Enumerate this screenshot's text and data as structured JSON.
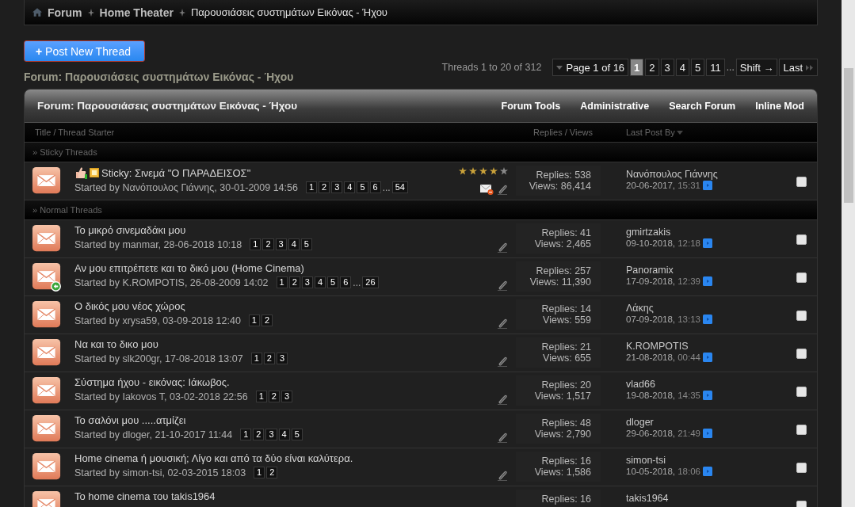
{
  "breadcrumb": {
    "items": [
      "Forum",
      "Home Theater"
    ],
    "current": "Παρουσιάσεις συστημάτων Εικόνας - Ήχου"
  },
  "post_button": {
    "icon": "+",
    "label": "Post New Thread"
  },
  "forum_heading": "Forum: Παρουσιάσεις συστημάτων Εικόνας - Ήχου",
  "pagination": {
    "summary": "Threads 1 to 20 of 312",
    "page_label": "Page 1 of 16",
    "pages": [
      {
        "label": "1",
        "selected": true
      },
      {
        "label": "2",
        "selected": false
      },
      {
        "label": "3",
        "selected": false
      },
      {
        "label": "4",
        "selected": false
      },
      {
        "label": "5",
        "selected": false
      },
      {
        "label": "11",
        "selected": false
      }
    ],
    "gap": "...",
    "next": "Shift →",
    "last": "Last"
  },
  "table": {
    "title": "Forum: Παρουσιάσεις συστημάτων Εικόνας - Ήχου",
    "tools": [
      "Forum Tools",
      "Administrative",
      "Search Forum",
      "Inline Mod"
    ],
    "columns": [
      "Title / Thread Starter",
      "Replies / Views",
      "Last Post By"
    ],
    "sections": [
      {
        "label": "» Sticky Threads",
        "threads": [
          {
            "kind": "sticky",
            "title": "Sticky: Σινεμά \"Ο ΠΑΡΑΔΕΙΣΟΣ\"",
            "starter": "Started by Νανόπουλος Γιάννης, 30-01-2009 14:56",
            "pages": [
              "1",
              "2",
              "3",
              "4",
              "5",
              "6"
            ],
            "gap": "...",
            "last_page": "54",
            "stars": 4,
            "moved": false,
            "replies": "Replies: 538",
            "views": "Views: 86,414",
            "last_poster": "Νανόπουλος Γιάννης",
            "last_date": "20-06-2017,",
            "last_time": "15:31",
            "checked": false
          }
        ]
      },
      {
        "label": "» Normal Threads",
        "threads": [
          {
            "kind": "normal",
            "title": "Το μικρό σινεμαδάκι μου",
            "starter": "Started by manmar, 28-06-2018 10:18",
            "pages": [
              "1",
              "2",
              "3",
              "4",
              "5"
            ],
            "moved": false,
            "replies": "Replies: 41",
            "views": "Views: 2,465",
            "last_poster": "gmirtzakis",
            "last_date": "09-10-2018,",
            "last_time": "12:18",
            "checked": false
          },
          {
            "kind": "normal",
            "title": "Αν μου επιτρέπετε και το δικό μου (Home Cinema)",
            "starter": "Started by K.ROMPOTIS, 26-08-2009 14:02",
            "pages": [
              "1",
              "2",
              "3",
              "4",
              "5",
              "6"
            ],
            "gap": "...",
            "last_page": "26",
            "moved": true,
            "replies": "Replies: 257",
            "views": "Views: 11,390",
            "last_poster": "Panoramix",
            "last_date": "17-09-2018,",
            "last_time": "12:39",
            "checked": false
          },
          {
            "kind": "normal",
            "title": "Ο δικός μου νέος χώρος",
            "starter": "Started by xrysa59, 03-09-2018 12:40",
            "pages": [
              "1",
              "2"
            ],
            "moved": false,
            "replies": "Replies: 14",
            "views": "Views: 559",
            "last_poster": "Λάκης",
            "last_date": "07-09-2018,",
            "last_time": "13:13",
            "checked": false
          },
          {
            "kind": "normal",
            "title": "Να και το δικο μου",
            "starter": "Started by slk200gr, 17-08-2018 13:07",
            "pages": [
              "1",
              "2",
              "3"
            ],
            "moved": false,
            "replies": "Replies: 21",
            "views": "Views: 655",
            "last_poster": "K.ROMPOTIS",
            "last_date": "21-08-2018,",
            "last_time": "00:44",
            "checked": false
          },
          {
            "kind": "normal",
            "title": "Σύστημα ήχου - εικόνας: Ιάκωβος.",
            "starter": "Started by Iakovos T, 03-02-2018 22:56",
            "pages": [
              "1",
              "2",
              "3"
            ],
            "moved": false,
            "replies": "Replies: 20",
            "views": "Views: 1,517",
            "last_poster": "vlad66",
            "last_date": "19-08-2018,",
            "last_time": "14:35",
            "checked": false
          },
          {
            "kind": "normal",
            "title": "Το σαλόνι μου .....ατμίζει",
            "starter": "Started by dloger, 21-10-2017 11:44",
            "pages": [
              "1",
              "2",
              "3",
              "4",
              "5"
            ],
            "moved": false,
            "replies": "Replies: 48",
            "views": "Views: 2,790",
            "last_poster": "dloger",
            "last_date": "29-06-2018,",
            "last_time": "21:49",
            "checked": false
          },
          {
            "kind": "normal",
            "title": "Home cinema ή μουσική; Λίγο και από τα δύο είναι καλύτερα.",
            "starter": "Started by simon-tsi, 02-03-2015 18:03",
            "pages": [
              "1",
              "2"
            ],
            "moved": false,
            "replies": "Replies: 16",
            "views": "Views: 1,586",
            "last_poster": "simon-tsi",
            "last_date": "10-05-2018,",
            "last_time": "18:06",
            "checked": false
          },
          {
            "kind": "normal",
            "title": "Το home cinema του takis1964",
            "replies": "Replies: 16",
            "last_poster": "takis1964",
            "checked": false
          }
        ]
      }
    ]
  }
}
